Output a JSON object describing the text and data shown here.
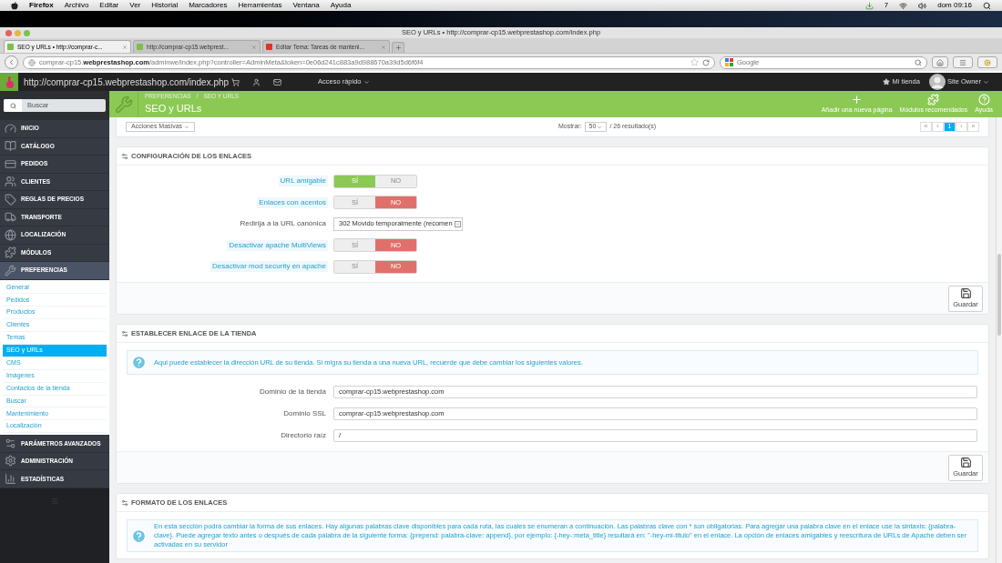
{
  "menubar": {
    "app": "Firefox",
    "items": [
      "Archivo",
      "Editar",
      "Ver",
      "Historial",
      "Marcadores",
      "Herramientas",
      "Ventana",
      "Ayuda"
    ],
    "badge": "7",
    "clock": "dom 09:16"
  },
  "window": {
    "title": "SEO y URLs • http://comprar-cp15.webprestashop.com/index.php"
  },
  "browser_tabs": [
    {
      "label": "SEO y URLs • http://comprar-c...",
      "selected": true
    },
    {
      "label": "http://comprar-cp15.webprest...",
      "selected": false
    },
    {
      "label": "Editar Tema: Tareas de manteni...",
      "selected": false
    }
  ],
  "address_bar": {
    "url": "comprar-cp15.**webprestashop.com**/adminwe/index.php?controller=AdminMeta&token=0e06d241c883a9d988670a39d5d6f6f4"
  },
  "search_engine": {
    "placeholder": "Google"
  },
  "admin_header": {
    "shop_url": "http://comprar-cp15.webprestashop.com/index.php",
    "quick_access": "Acceso rápido",
    "my_shop": "Mi tienda",
    "user": "Site Owner"
  },
  "sidebar": {
    "search_placeholder": "Buscar",
    "items": [
      {
        "label": "INICIO",
        "selected": false
      },
      {
        "label": "CATÁLOGO",
        "selected": false
      },
      {
        "label": "PEDIDOS",
        "selected": false
      },
      {
        "label": "CLIENTES",
        "selected": false
      },
      {
        "label": "REGLAS DE PRECIOS",
        "selected": false
      },
      {
        "label": "TRANSPORTE",
        "selected": false
      },
      {
        "label": "LOCALIZACIÓN",
        "selected": false
      },
      {
        "label": "MÓDULOS",
        "selected": false
      },
      {
        "label": "PREFERENCIAS",
        "selected": true,
        "children": [
          {
            "label": "General",
            "selected": false
          },
          {
            "label": "Pedidos",
            "selected": false
          },
          {
            "label": "Productos",
            "selected": false
          },
          {
            "label": "Clientes",
            "selected": false
          },
          {
            "label": "Temas",
            "selected": false
          },
          {
            "label": "SEO y URLs",
            "selected": true
          },
          {
            "label": "CMS",
            "selected": false
          },
          {
            "label": "Imágenes",
            "selected": false
          },
          {
            "label": "Contactos de la tienda",
            "selected": false
          },
          {
            "label": "Buscar",
            "selected": false
          },
          {
            "label": "Mantenimiento",
            "selected": false
          },
          {
            "label": "Localización",
            "selected": false
          }
        ]
      },
      {
        "label": "PARÁMETROS AVANZADOS",
        "selected": false
      },
      {
        "label": "ADMINISTRACIÓN",
        "selected": false
      },
      {
        "label": "ESTADÍSTICAS",
        "selected": false
      }
    ]
  },
  "page_header": {
    "breadcrumb": [
      "PREFERENCIAS",
      "SEO Y URLS"
    ],
    "breadcrumb_separator": "/",
    "title": "SEO y URLs",
    "actions": [
      "Añadir una nueva página",
      "Módulos recomendados",
      "Ayuda"
    ]
  },
  "list_toolbar": {
    "bulk_actions": "Acciones Masivas",
    "show_label": "Mostrar:",
    "per_page": "50",
    "results": "/ 26 resultado(s)",
    "pages": [
      {
        "label": "«",
        "selected": false
      },
      {
        "label": "‹",
        "selected": false
      },
      {
        "label": "1",
        "selected": true
      },
      {
        "label": "›",
        "selected": false
      },
      {
        "label": "»",
        "selected": false
      }
    ]
  },
  "panels": [
    {
      "title": "CONFIGURACIÓN DE LOS ENLACES",
      "fields": [
        {
          "kind": "toggle",
          "label": "URL amigable",
          "hint": true,
          "yes": "SÍ",
          "no": "NO",
          "on": true
        },
        {
          "kind": "toggle",
          "label": "Enlaces con acentos",
          "hint": true,
          "yes": "SÍ",
          "no": "NO",
          "on": false
        },
        {
          "kind": "select",
          "label": "Redirija a la URL canónica",
          "hint": false,
          "value": "302 Movido temporalmente (recomen"
        },
        {
          "kind": "toggle",
          "label": "Desactivar apache MultiViews",
          "hint": true,
          "yes": "SÍ",
          "no": "NO",
          "on": false
        },
        {
          "kind": "toggle",
          "label": "Desactivar mod security en apache",
          "hint": true,
          "yes": "SÍ",
          "no": "NO",
          "on": false
        }
      ],
      "save": "Guardar"
    },
    {
      "title": "ESTABLECER ENLACE DE LA TIENDA",
      "info": "Aqui puede establecer la dirección URL de su tienda. Si migra su tienda a una nueva URL, recuerde que debe cambiar los siguientes valores.",
      "fields": [
        {
          "kind": "text",
          "label": "Dominio de la tienda",
          "hint": false,
          "value": "comprar-cp15.webprestashop.com"
        },
        {
          "kind": "text",
          "label": "Dominio SSL",
          "hint": false,
          "value": "comprar-cp15.webprestashop.com"
        },
        {
          "kind": "text",
          "label": "Directorio raíz",
          "hint": false,
          "value": "/"
        }
      ],
      "save": "Guardar"
    },
    {
      "title": "FORMATO DE LOS ENLACES",
      "info": "En esta sección podrá cambiar la forma de sus enlaces. Hay algunas palabras clave disponibles para cada ruta, las cuales se enumeran a continuación. Las palabras clave con * son obligatorias. Para agregar una palabra clave en el enlace use la sintaxis: {palabra-clave}. Puede agregar texto antes o después de cada palabra de la siguiente forma: {prepend: palabra-clave: append}, por ejemplo: {-hey-:meta_title} resultará en: \"-hey-mi-titulo\" en el enlace. La opción de enlaces amigables y reescritura de URLs de Apache deben ser activadas en su servidor"
    }
  ]
}
